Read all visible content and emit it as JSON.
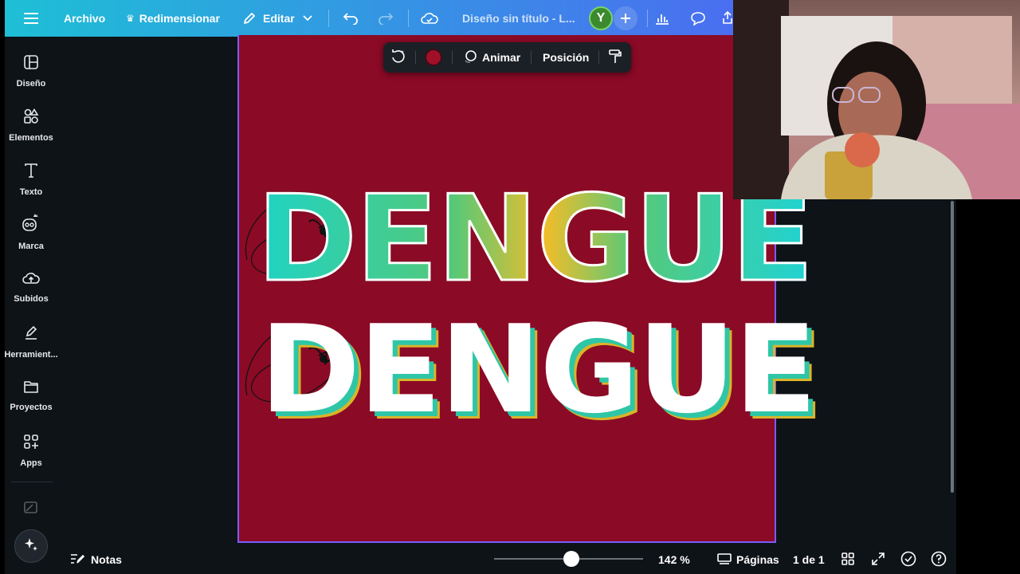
{
  "topbar": {
    "menu_label": "",
    "file_label": "Archivo",
    "resize_label": "Redimensionar",
    "edit_label": "Editar",
    "doc_title": "Diseño sin título - L...",
    "avatar_initial": "Y"
  },
  "sidebar": {
    "items": [
      {
        "label": "Diseño",
        "icon": "layout-icon"
      },
      {
        "label": "Elementos",
        "icon": "shapes-icon"
      },
      {
        "label": "Texto",
        "icon": "text-icon"
      },
      {
        "label": "Marca",
        "icon": "brand-icon"
      },
      {
        "label": "Subidos",
        "icon": "cloud-upload-icon"
      },
      {
        "label": "Herramient...",
        "icon": "pen-tool-icon"
      },
      {
        "label": "Proyectos",
        "icon": "folder-icon"
      },
      {
        "label": "Apps",
        "icon": "apps-grid-icon"
      }
    ]
  },
  "context_toolbar": {
    "color": "#a01028",
    "animate_label": "Animar",
    "position_label": "Posición"
  },
  "canvas": {
    "page_bg": "#8b0a26",
    "text_1": "DENGUE",
    "text_2": "DENGUE"
  },
  "bottombar": {
    "notes_label": "Notas",
    "zoom_label": "142 %",
    "zoom_percent": 142,
    "pages_label": "Páginas",
    "page_counter": "1 de 1"
  },
  "colors": {
    "accent_gradient_start": "#1ebfd6",
    "accent_gradient_end": "#4a6ef0",
    "selection_border": "#7a5cff",
    "panel_bg": "#0e1318"
  }
}
